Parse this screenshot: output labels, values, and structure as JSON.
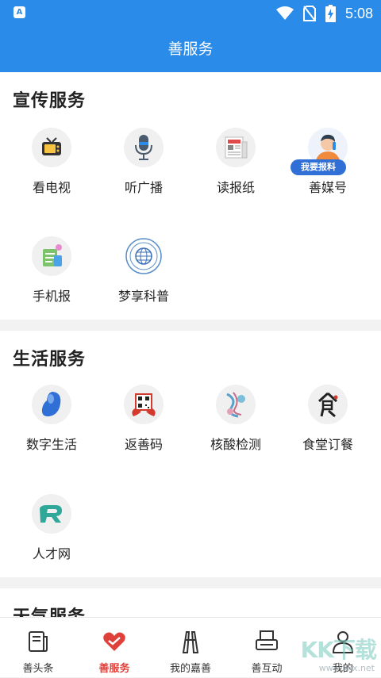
{
  "status": {
    "app_badge": "A",
    "time": "5:08"
  },
  "appbar": {
    "title": "善服务"
  },
  "sections": [
    {
      "title": "宣传服务",
      "items": [
        {
          "label": "看电视",
          "icon": "tv-icon"
        },
        {
          "label": "听广播",
          "icon": "microphone-icon"
        },
        {
          "label": "读报纸",
          "icon": "newspaper-icon"
        },
        {
          "label": "善媒号",
          "icon": "reporter-icon",
          "badge": "我要报料"
        },
        {
          "label": "手机报",
          "icon": "mobile-news-icon"
        },
        {
          "label": "梦享科普",
          "icon": "science-emblem-icon"
        }
      ]
    },
    {
      "title": "生活服务",
      "items": [
        {
          "label": "数字生活",
          "icon": "blue-shape-icon"
        },
        {
          "label": "返善码",
          "icon": "qr-code-icon"
        },
        {
          "label": "核酸检测",
          "icon": "virus-test-icon"
        },
        {
          "label": "食堂订餐",
          "icon": "canteen-icon"
        },
        {
          "label": "人才网",
          "icon": "talent-r-icon"
        }
      ]
    },
    {
      "title": "天气服务",
      "items": []
    }
  ],
  "tabs": [
    {
      "label": "善头条",
      "icon": "news-tab-icon",
      "active": false
    },
    {
      "label": "善服务",
      "icon": "heart-tab-icon",
      "active": true
    },
    {
      "label": "我的嘉善",
      "icon": "landmark-tab-icon",
      "active": false
    },
    {
      "label": "善互动",
      "icon": "interaction-tab-icon",
      "active": false
    },
    {
      "label": "我的",
      "icon": "profile-tab-icon",
      "active": false
    }
  ],
  "colors": {
    "primary": "#2a8be8",
    "accent_red": "#e0403a",
    "badge_blue": "#2f6fd6"
  },
  "watermark": {
    "text": "KK下载",
    "url": "www.kkx.net"
  }
}
